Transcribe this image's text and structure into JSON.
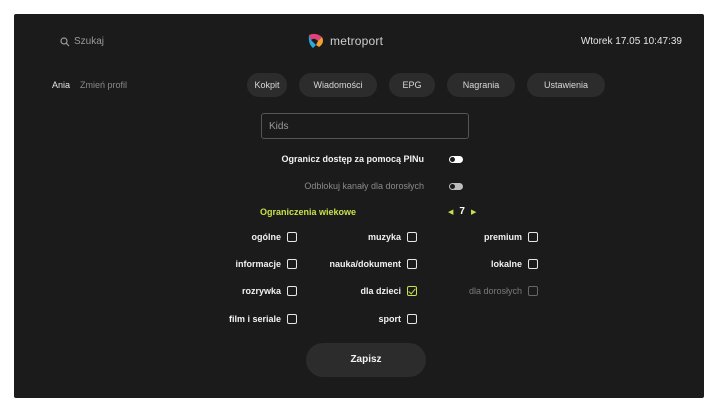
{
  "header": {
    "search_label": "Szukaj",
    "brand": "metroport",
    "datetime": "Wtorek 17.05 10:47:39"
  },
  "profile": {
    "name": "Ania",
    "switch_label": "Zmień profil"
  },
  "nav": [
    {
      "label": "Kokpit"
    },
    {
      "label": "Wiadomości"
    },
    {
      "label": "EPG"
    },
    {
      "label": "Nagrania"
    },
    {
      "label": "Ustawienia"
    }
  ],
  "form": {
    "profile_name_value": "Kids",
    "pin_label": "Ogranicz dostęp za pomocą PINu",
    "pin_enabled": true,
    "adult_label": "Odblokuj kanały dla dorosłych",
    "adult_enabled": false,
    "age_label": "Ograniczenia wiekowe",
    "age_value": "7",
    "save_label": "Zapisz"
  },
  "categories": [
    {
      "label": "ogólne",
      "checked": false,
      "enabled": true
    },
    {
      "label": "muzyka",
      "checked": false,
      "enabled": true
    },
    {
      "label": "premium",
      "checked": false,
      "enabled": true
    },
    {
      "label": "informacje",
      "checked": false,
      "enabled": true
    },
    {
      "label": "nauka/dokument",
      "checked": false,
      "enabled": true
    },
    {
      "label": "lokalne",
      "checked": false,
      "enabled": true
    },
    {
      "label": "rozrywka",
      "checked": false,
      "enabled": true
    },
    {
      "label": "dla dzieci",
      "checked": true,
      "enabled": true
    },
    {
      "label": "dla dorosłych",
      "checked": false,
      "enabled": false
    },
    {
      "label": "film i seriale",
      "checked": false,
      "enabled": true
    },
    {
      "label": "sport",
      "checked": false,
      "enabled": true
    }
  ],
  "colors": {
    "accent": "#c9e04a",
    "background": "#1b1b1b",
    "pill": "#2c2c2c"
  }
}
